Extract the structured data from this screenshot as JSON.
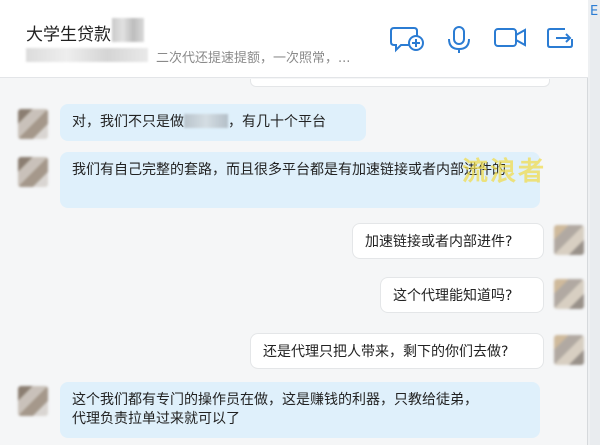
{
  "header": {
    "title": "大学生贷款",
    "subtitle": "二次代还提速提额，一次照常，..."
  },
  "watermark": "流浪者",
  "messages": [
    {
      "side": "in",
      "parts": [
        "对，我们不只是做",
        "，有几十个平台"
      ]
    },
    {
      "side": "in",
      "text": "我们有自己完整的套路，而且很多平台都是有加速链接或者内部进件的"
    },
    {
      "side": "out",
      "text": "加速链接或者内部进件?"
    },
    {
      "side": "out",
      "text": "这个代理能知道吗?"
    },
    {
      "side": "out",
      "text": "还是代理只把人带来，剩下的你们去做?"
    },
    {
      "side": "in",
      "lines": [
        "这个我们都有专门的操作员在做，这是赚钱的利器，只教给徒弟，",
        "代理负责拉单过来就可以了"
      ]
    }
  ],
  "colors": {
    "accent": "#2b7cd3",
    "incoming_bubble": "#dff0fb",
    "outgoing_bubble": "#ffffff"
  },
  "icons": [
    "add-chat-icon",
    "microphone-icon",
    "video-camera-icon",
    "share-icon"
  ]
}
